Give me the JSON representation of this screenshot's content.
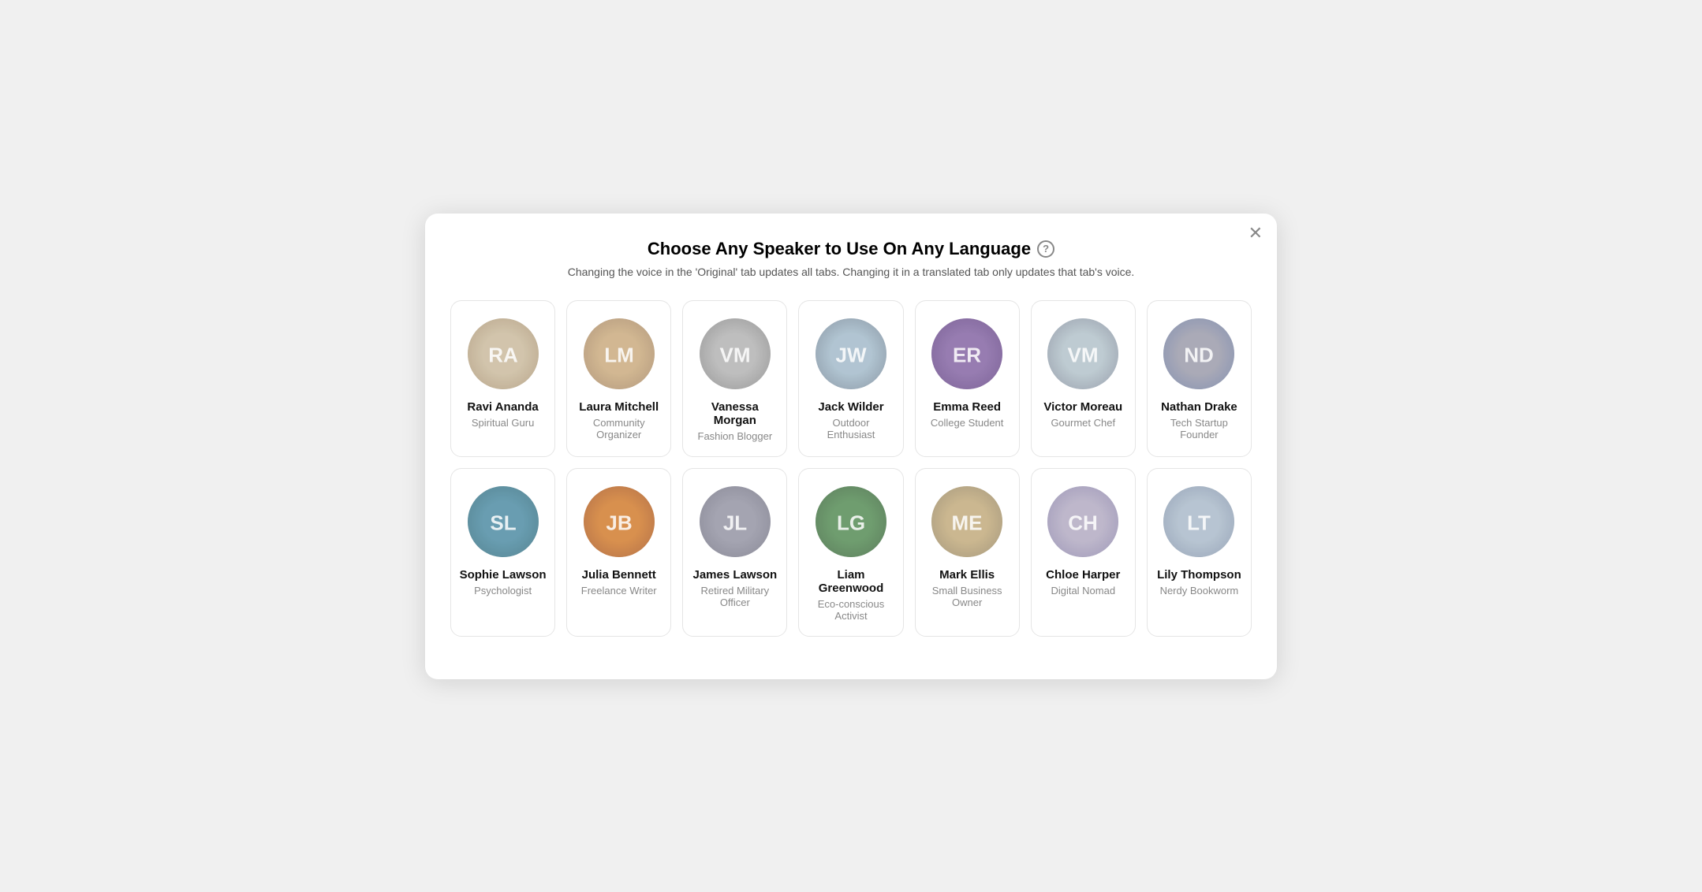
{
  "modal": {
    "title": "Choose Any Speaker to Use On Any Language",
    "subtitle": "Changing the voice in the 'Original' tab updates all tabs. Changing it in a translated tab only updates that tab's voice.",
    "close_label": "✕",
    "help_label": "?"
  },
  "speakers_row1": [
    {
      "id": "ravi",
      "name": "Ravi Ananda",
      "role": "Spiritual Guru",
      "av_class": "av-ravi",
      "initials": "RA"
    },
    {
      "id": "laura",
      "name": "Laura Mitchell",
      "role": "Community Organizer",
      "av_class": "av-laura",
      "initials": "LM"
    },
    {
      "id": "vanessa",
      "name": "Vanessa Morgan",
      "role": "Fashion Blogger",
      "av_class": "av-vanessa",
      "initials": "VM"
    },
    {
      "id": "jack",
      "name": "Jack Wilder",
      "role": "Outdoor Enthusiast",
      "av_class": "av-jack",
      "initials": "JW"
    },
    {
      "id": "emma",
      "name": "Emma Reed",
      "role": "College Student",
      "av_class": "av-emma",
      "initials": "ER"
    },
    {
      "id": "victor",
      "name": "Victor Moreau",
      "role": "Gourmet Chef",
      "av_class": "av-victor",
      "initials": "VM"
    },
    {
      "id": "nathan",
      "name": "Nathan Drake",
      "role": "Tech Startup Founder",
      "av_class": "av-nathan",
      "initials": "ND"
    }
  ],
  "speakers_row2": [
    {
      "id": "sophie",
      "name": "Sophie Lawson",
      "role": "Psychologist",
      "av_class": "av-sophie",
      "initials": "SL"
    },
    {
      "id": "julia",
      "name": "Julia Bennett",
      "role": "Freelance Writer",
      "av_class": "av-julia",
      "initials": "JB"
    },
    {
      "id": "james",
      "name": "James Lawson",
      "role": "Retired Military Officer",
      "av_class": "av-james",
      "initials": "JL"
    },
    {
      "id": "liam",
      "name": "Liam Greenwood",
      "role": "Eco-conscious Activist",
      "av_class": "av-liam",
      "initials": "LG"
    },
    {
      "id": "mark",
      "name": "Mark Ellis",
      "role": "Small Business Owner",
      "av_class": "av-mark",
      "initials": "ME"
    },
    {
      "id": "chloe",
      "name": "Chloe Harper",
      "role": "Digital Nomad",
      "av_class": "av-chloe",
      "initials": "CH"
    },
    {
      "id": "lily",
      "name": "Lily Thompson",
      "role": "Nerdy Bookworm",
      "av_class": "av-lily",
      "initials": "LT"
    }
  ]
}
